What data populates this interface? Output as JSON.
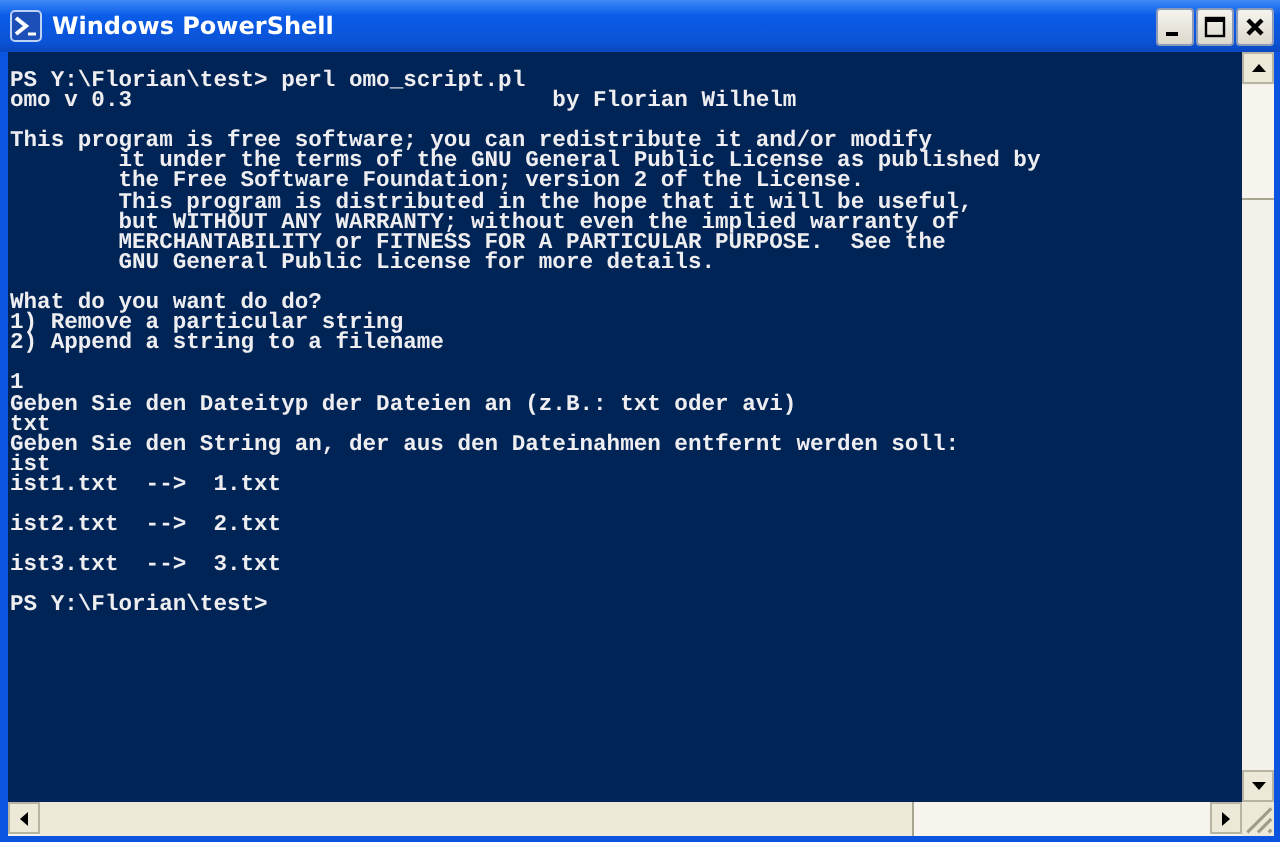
{
  "window": {
    "title": "Windows PowerShell"
  },
  "console": {
    "blocks": [
      [
        "PS Y:\\Florian\\test> perl omo_script.pl",
        "omo v 0.3                               by Florian Wilhelm"
      ],
      [
        "This program is free software; you can redistribute it and/or modify",
        "        it under the terms of the GNU General Public License as published by",
        "        the Free Software Foundation; version 2 of the License.",
        "        This program is distributed in the hope that it will be useful,",
        "        but WITHOUT ANY WARRANTY; without even the implied warranty of",
        "        MERCHANTABILITY or FITNESS FOR A PARTICULAR PURPOSE.  See the",
        "        GNU General Public License for more details."
      ],
      [
        "What do you want do do?",
        "1) Remove a particular string",
        "2) Append a string to a filename"
      ],
      [
        "1",
        "Geben Sie den Dateityp der Dateien an (z.B.: txt oder avi)",
        "txt",
        "Geben Sie den String an, der aus den Dateinahmen entfernt werden soll:",
        "ist",
        "ist1.txt  -->  1.txt"
      ],
      [
        "ist2.txt  -->  2.txt"
      ],
      [
        "ist3.txt  -->  3.txt"
      ],
      [
        "PS Y:\\Florian\\test>"
      ]
    ]
  }
}
